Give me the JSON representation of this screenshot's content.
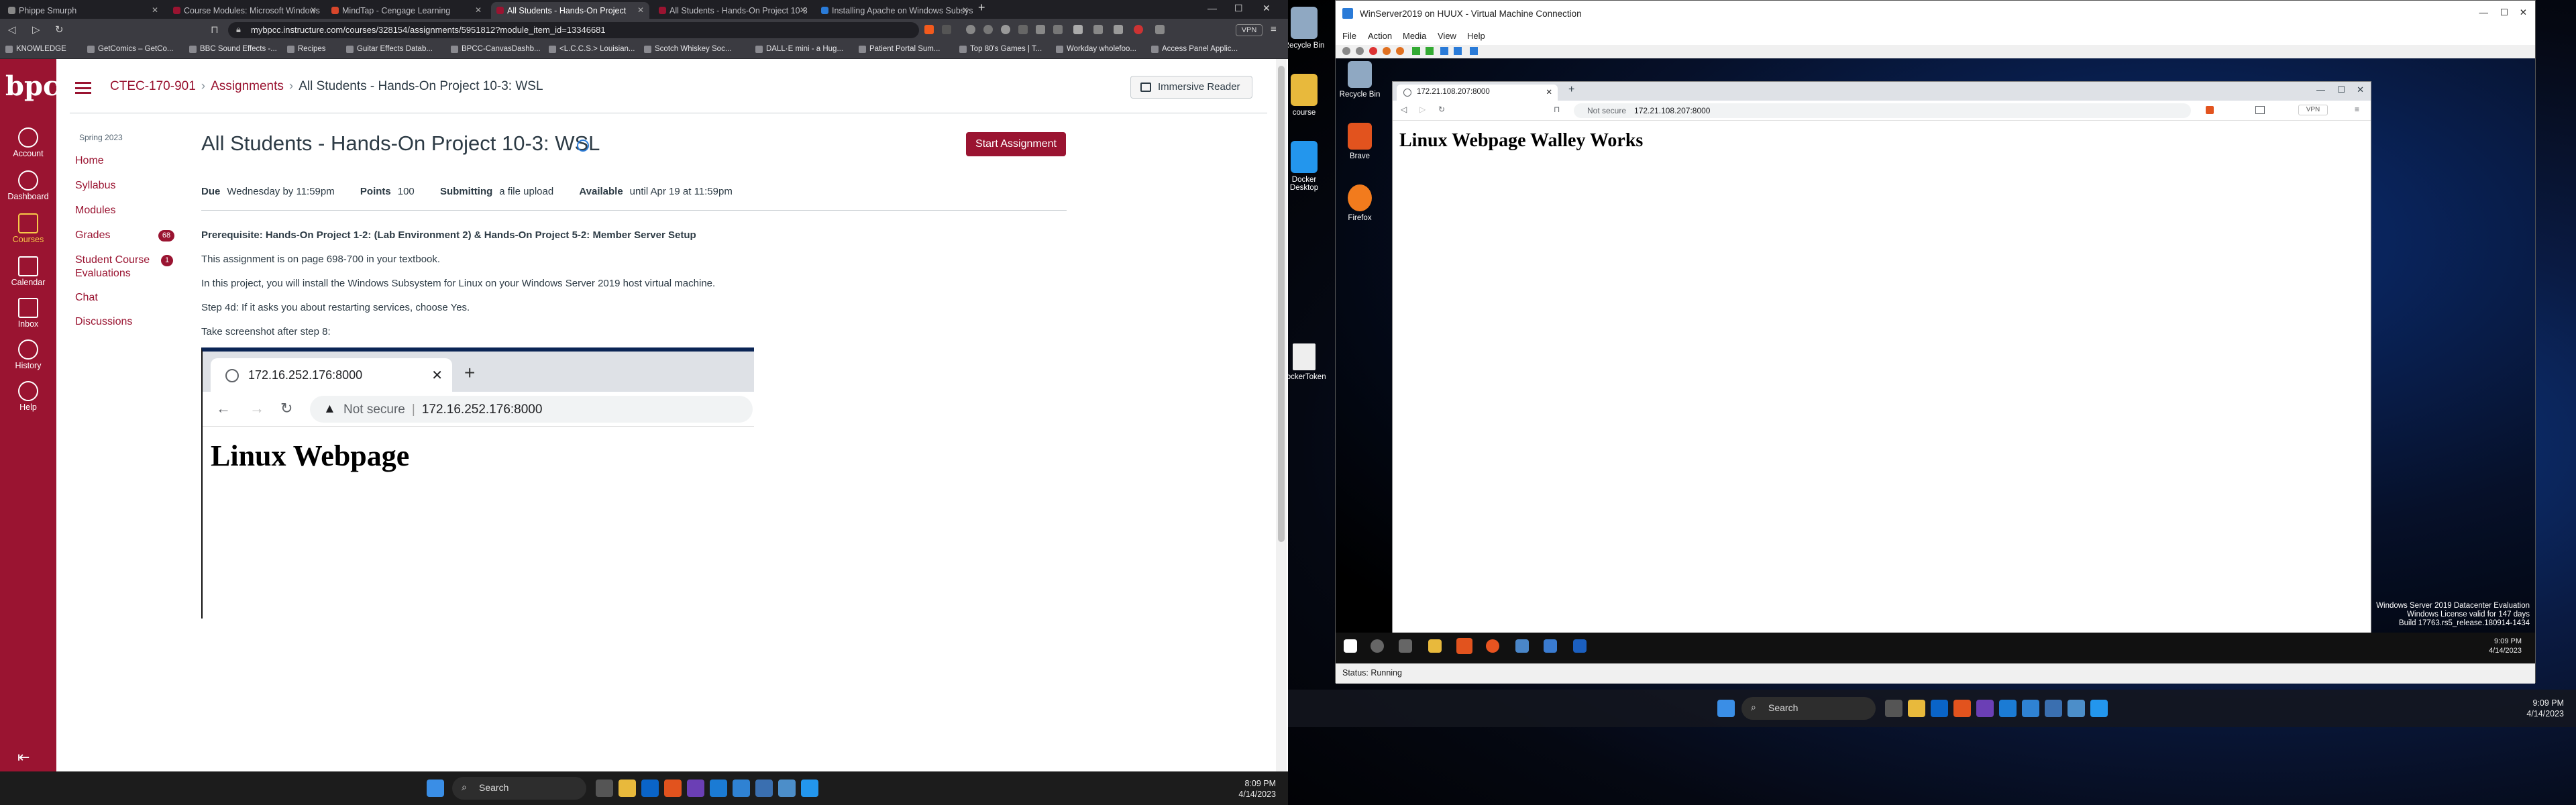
{
  "left_browser": {
    "tabs": [
      {
        "label": "Phippe Smurph",
        "active": false
      },
      {
        "label": "Course Modules: Microsoft Windows",
        "active": false
      },
      {
        "label": "MindTap - Cengage Learning",
        "active": false
      },
      {
        "label": "All Students - Hands-On Project",
        "active": true
      },
      {
        "label": "All Students - Hands-On Project 10-3",
        "active": false
      },
      {
        "label": "Installing Apache on Windows Subsys",
        "active": false
      }
    ],
    "url": "mybpcc.instructure.com/courses/328154/assignments/5951812?module_item_id=13346681",
    "vpn_label": "VPN",
    "bookmarks": [
      "KNOWLEDGE",
      "GetComics – GetCo...",
      "BBC Sound Effects -...",
      "Recipes",
      "Guitar Effects Datab...",
      "BPCC-CanvasDashb...",
      "<L.C.C.S.> Louisian...",
      "Scotch Whiskey Soc...",
      "DALL·E mini - a Hug...",
      "Patient Portal Sum...",
      "Top 80's Games | T...",
      "Workday wholefoo...",
      "Access Panel Applic..."
    ]
  },
  "global_nav": {
    "logo": "bpcc",
    "items": [
      {
        "label": "Account",
        "icon": "account-icon"
      },
      {
        "label": "Dashboard",
        "icon": "dashboard-icon"
      },
      {
        "label": "Courses",
        "icon": "courses-icon"
      },
      {
        "label": "Calendar",
        "icon": "calendar-icon"
      },
      {
        "label": "Inbox",
        "icon": "inbox-icon"
      },
      {
        "label": "History",
        "icon": "history-icon"
      },
      {
        "label": "Help",
        "icon": "help-icon"
      }
    ]
  },
  "breadcrumb": [
    "CTEC-170-901",
    "Assignments",
    "All Students - Hands-On Project 10-3: WSL"
  ],
  "immersive_reader": "Immersive Reader",
  "course_nav": {
    "term": "Spring 2023",
    "links": [
      {
        "label": "Home"
      },
      {
        "label": "Syllabus"
      },
      {
        "label": "Modules"
      },
      {
        "label": "Grades",
        "badge": "68"
      },
      {
        "label": "Student Course Evaluations",
        "badge": "1"
      },
      {
        "label": "Chat"
      },
      {
        "label": "Discussions"
      }
    ]
  },
  "assignment": {
    "title": "All Students - Hands-On Project 10-3: WSL",
    "start_button": "Start Assignment",
    "due_label": "Due",
    "due_value": "Wednesday by 11:59pm",
    "points_label": "Points",
    "points_value": "100",
    "submitting_label": "Submitting",
    "submitting_value": "a file upload",
    "available_label": "Available",
    "available_value": "until Apr 19 at 11:59pm",
    "prerequisite": "Prerequisite: Hands-On Project 1-2: (Lab Environment 2) & Hands-On Project 5-2: Member Server Setup",
    "para1": "This assignment is on page 698-700 in your textbook.",
    "para2": "In this project, you will install the Windows Subsystem for Linux on your Windows Server 2019 host virtual machine.",
    "para3": "Step 4d: If it asks you about restarting services, choose Yes.",
    "para4": "Take screenshot after step 8:"
  },
  "embedded_shot": {
    "tab_title": "172.16.252.176:8000",
    "not_secure": "Not secure",
    "url": "172.16.252.176:8000",
    "heading": "Linux Webpage"
  },
  "left_taskbar": {
    "search": "Search",
    "time": "8:09 PM",
    "date": "4/14/2023"
  },
  "right_desktop": {
    "icons": [
      "Recycle Bin",
      "course",
      "Docker Desktop",
      "dockerToken"
    ]
  },
  "vm": {
    "title": "WinServer2019 on HUUX - Virtual Machine Connection",
    "menu": [
      "File",
      "Action",
      "Media",
      "View",
      "Help"
    ],
    "status": "Status: Running",
    "guest_icons": [
      "Recycle Bin",
      "Brave",
      "Firefox"
    ],
    "guest_browser": {
      "tab_title": "172.21.108.207:8000",
      "not_secure": "Not secure",
      "url": "172.21.108.207:8000",
      "vpn_label": "VPN",
      "heading": "Linux Webpage Walley Works"
    },
    "license_lines": [
      "Windows Server 2019 Datacenter Evaluation",
      "Windows License valid for 147 days",
      "Build 17763.rs5_release.180914-1434"
    ],
    "guest_time": "9:09 PM",
    "guest_date": "4/14/2023"
  },
  "right_taskbar": {
    "search": "Search",
    "time": "9:09 PM",
    "date": "4/14/2023"
  }
}
